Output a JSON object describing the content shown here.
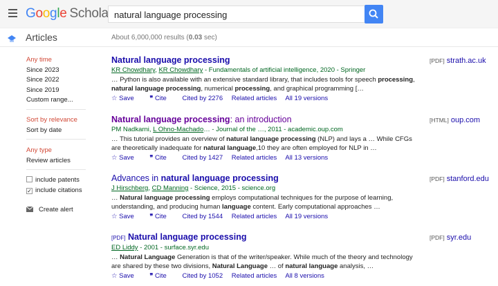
{
  "header": {
    "logo_google": "Google",
    "logo_scholar": "Scholar",
    "search_value": "natural language processing"
  },
  "subheader": {
    "section": "Articles",
    "results": "About 6,000,000 results (",
    "results_time": "0.03",
    "results_end": " sec)"
  },
  "sidebar": {
    "time": [
      "Any time",
      "Since 2023",
      "Since 2022",
      "Since 2019",
      "Custom range..."
    ],
    "sort": [
      "Sort by relevance",
      "Sort by date"
    ],
    "type": [
      "Any type",
      "Review articles"
    ],
    "include_patents": "include patents",
    "include_citations": "include citations",
    "create_alert": "Create alert"
  },
  "results": [
    {
      "title_parts": [
        [
          "b",
          "Natural language processing"
        ]
      ],
      "visited": false,
      "authors": [
        [
          "u",
          "KR Chowdhary"
        ],
        [
          "t",
          ", "
        ],
        [
          "u",
          "KR Chowdhary"
        ],
        [
          "t",
          " - Fundamentals of artificial intelligence, 2020 - Springer"
        ]
      ],
      "snippet": [
        [
          "t",
          "… Python is also available with an extensive standard library, that includes tools for speech "
        ],
        [
          "b",
          "processing"
        ],
        [
          "t",
          ", "
        ],
        [
          "b",
          "natural language processing"
        ],
        [
          "t",
          ", numerical "
        ],
        [
          "b",
          "processing"
        ],
        [
          "t",
          ", and graphical programming […"
        ]
      ],
      "cited": "Cited by 2276",
      "versions": "All 19 versions",
      "side_tag": "[PDF]",
      "side_link": "strath.ac.uk"
    },
    {
      "title_parts": [
        [
          "b",
          "Natural language processing"
        ],
        [
          "t",
          ": an introduction"
        ]
      ],
      "visited": true,
      "authors": [
        [
          "t",
          "PM Nadkarni, "
        ],
        [
          "u",
          "L Ohno-Machado"
        ],
        [
          "t",
          "… - Journal of the …, 2011 - academic.oup.com"
        ]
      ],
      "snippet": [
        [
          "t",
          "… This tutorial provides an overview of "
        ],
        [
          "b",
          "natural language processing"
        ],
        [
          "t",
          " (NLP) and lays a … While CFGs are theoretically inadequate for "
        ],
        [
          "b",
          "natural language"
        ],
        [
          "t",
          ",10 they are often employed for NLP in …"
        ]
      ],
      "cited": "Cited by 1427",
      "versions": "All 13 versions",
      "side_tag": "[HTML]",
      "side_link": "oup.com"
    },
    {
      "title_parts": [
        [
          "t",
          "Advances in "
        ],
        [
          "b",
          "natural language processing"
        ]
      ],
      "visited": false,
      "authors": [
        [
          "u",
          "J Hirschberg"
        ],
        [
          "t",
          ", "
        ],
        [
          "u",
          "CD Manning"
        ],
        [
          "t",
          " - Science, 2015 - science.org"
        ]
      ],
      "snippet": [
        [
          "t",
          "… "
        ],
        [
          "b",
          "Natural language processing"
        ],
        [
          "t",
          " employs computational techniques for the purpose of learning, understanding, and producing human "
        ],
        [
          "b",
          "language"
        ],
        [
          "t",
          " content. Early computational approaches …"
        ]
      ],
      "cited": "Cited by 1544",
      "versions": "All 19 versions",
      "side_tag": "[PDF]",
      "side_link": "stanford.edu"
    },
    {
      "title_tag": "[PDF]",
      "title_parts": [
        [
          "b",
          "Natural language processing"
        ]
      ],
      "visited": false,
      "authors": [
        [
          "u",
          "ED Liddy"
        ],
        [
          "t",
          " - 2001 - surface.syr.edu"
        ]
      ],
      "snippet": [
        [
          "t",
          "… "
        ],
        [
          "b",
          "Natural Language"
        ],
        [
          "t",
          " Generation is that of the writer/speaker. While much of the theory and technology are shared by these two divisions, "
        ],
        [
          "b",
          "Natural Language"
        ],
        [
          "t",
          " … of "
        ],
        [
          "b",
          "natural language"
        ],
        [
          "t",
          " analysis, …"
        ]
      ],
      "cited": "Cited by 1052",
      "versions": "All 8 versions",
      "side_tag": "[PDF]",
      "side_link": "syr.edu"
    }
  ],
  "actions": {
    "save": "Save",
    "cite": "Cite",
    "related": "Related articles"
  },
  "colors": {
    "link": "#1a0dab",
    "visited": "#660099",
    "author": "#006621",
    "accent": "#4285f4",
    "sidebar_active": "#d14836"
  }
}
